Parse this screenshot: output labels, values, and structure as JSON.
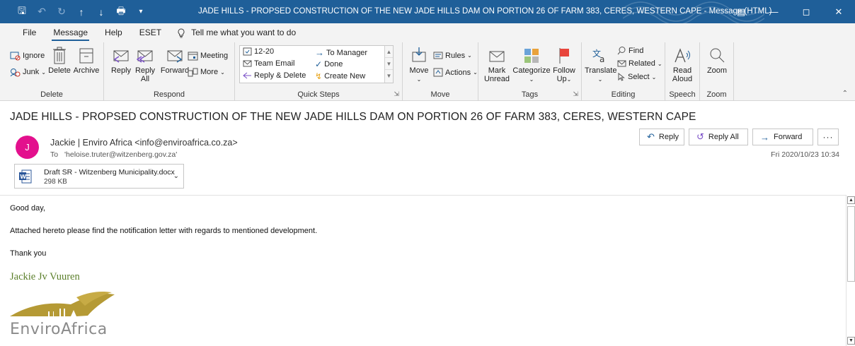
{
  "window": {
    "title": "JADE HILLS - PROPSED CONSTRUCTION OF THE NEW JADE HILLS DAM ON PORTION 26 OF FARM 383, CERES, WESTERN CAPE  -  Message (HTML)",
    "accent": "#1f5f99"
  },
  "menu": {
    "tabs": [
      "File",
      "Message",
      "Help",
      "ESET"
    ],
    "active_tab": "Message",
    "tell_me": "Tell me what you want to do"
  },
  "ribbon": {
    "delete_group": {
      "label": "Delete",
      "ignore": "Ignore",
      "junk": "Junk",
      "delete": "Delete",
      "archive": "Archive"
    },
    "respond_group": {
      "label": "Respond",
      "reply": "Reply",
      "reply_all_1": "Reply",
      "reply_all_2": "All",
      "forward": "Forward",
      "meeting": "Meeting",
      "more": "More"
    },
    "quick_steps_group": {
      "label": "Quick Steps",
      "items": [
        "12-20",
        "Team Email",
        "Reply & Delete",
        "To Manager",
        "Done",
        "Create New"
      ]
    },
    "move_group": {
      "label": "Move",
      "move": "Move",
      "rules": "Rules",
      "actions": "Actions"
    },
    "tags_group": {
      "label": "Tags",
      "mark_unread_1": "Mark",
      "mark_unread_2": "Unread",
      "categorize": "Categorize",
      "follow_up_1": "Follow",
      "follow_up_2": "Up"
    },
    "editing_group": {
      "label": "Editing",
      "translate": "Translate",
      "find": "Find",
      "related": "Related",
      "select": "Select"
    },
    "speech_group": {
      "label": "Speech",
      "read_aloud_1": "Read",
      "read_aloud_2": "Aloud"
    },
    "zoom_group": {
      "label": "Zoom",
      "zoom": "Zoom"
    }
  },
  "message": {
    "subject": "JADE HILLS - PROPSED CONSTRUCTION OF THE NEW JADE HILLS DAM ON PORTION 26 OF FARM 383, CERES, WESTERN CAPE",
    "avatar_initial": "J",
    "avatar_color": "#e3108d",
    "sender": "Jackie | Enviro Africa <info@enviroafrica.co.za>",
    "to_label": "To",
    "to_value": "'heloise.truter@witzenberg.gov.za'",
    "datetime": "Fri 2020/10/23 10:34",
    "actions": {
      "reply": "Reply",
      "reply_all": "Reply All",
      "forward": "Forward",
      "more": "···"
    },
    "attachment": {
      "name": "Draft SR - Witzenberg Municipality.docx",
      "size": "298 KB"
    },
    "body": {
      "greeting": "Good day,",
      "line1": "Attached hereto please find the notification letter with regards to mentioned development.",
      "closing": "Thank you"
    },
    "signature": {
      "name": "Jackie Jv Vuuren",
      "company": "EnviroAfrica",
      "name_color": "#5b7f2b",
      "logo_color": "#b59a35"
    }
  }
}
